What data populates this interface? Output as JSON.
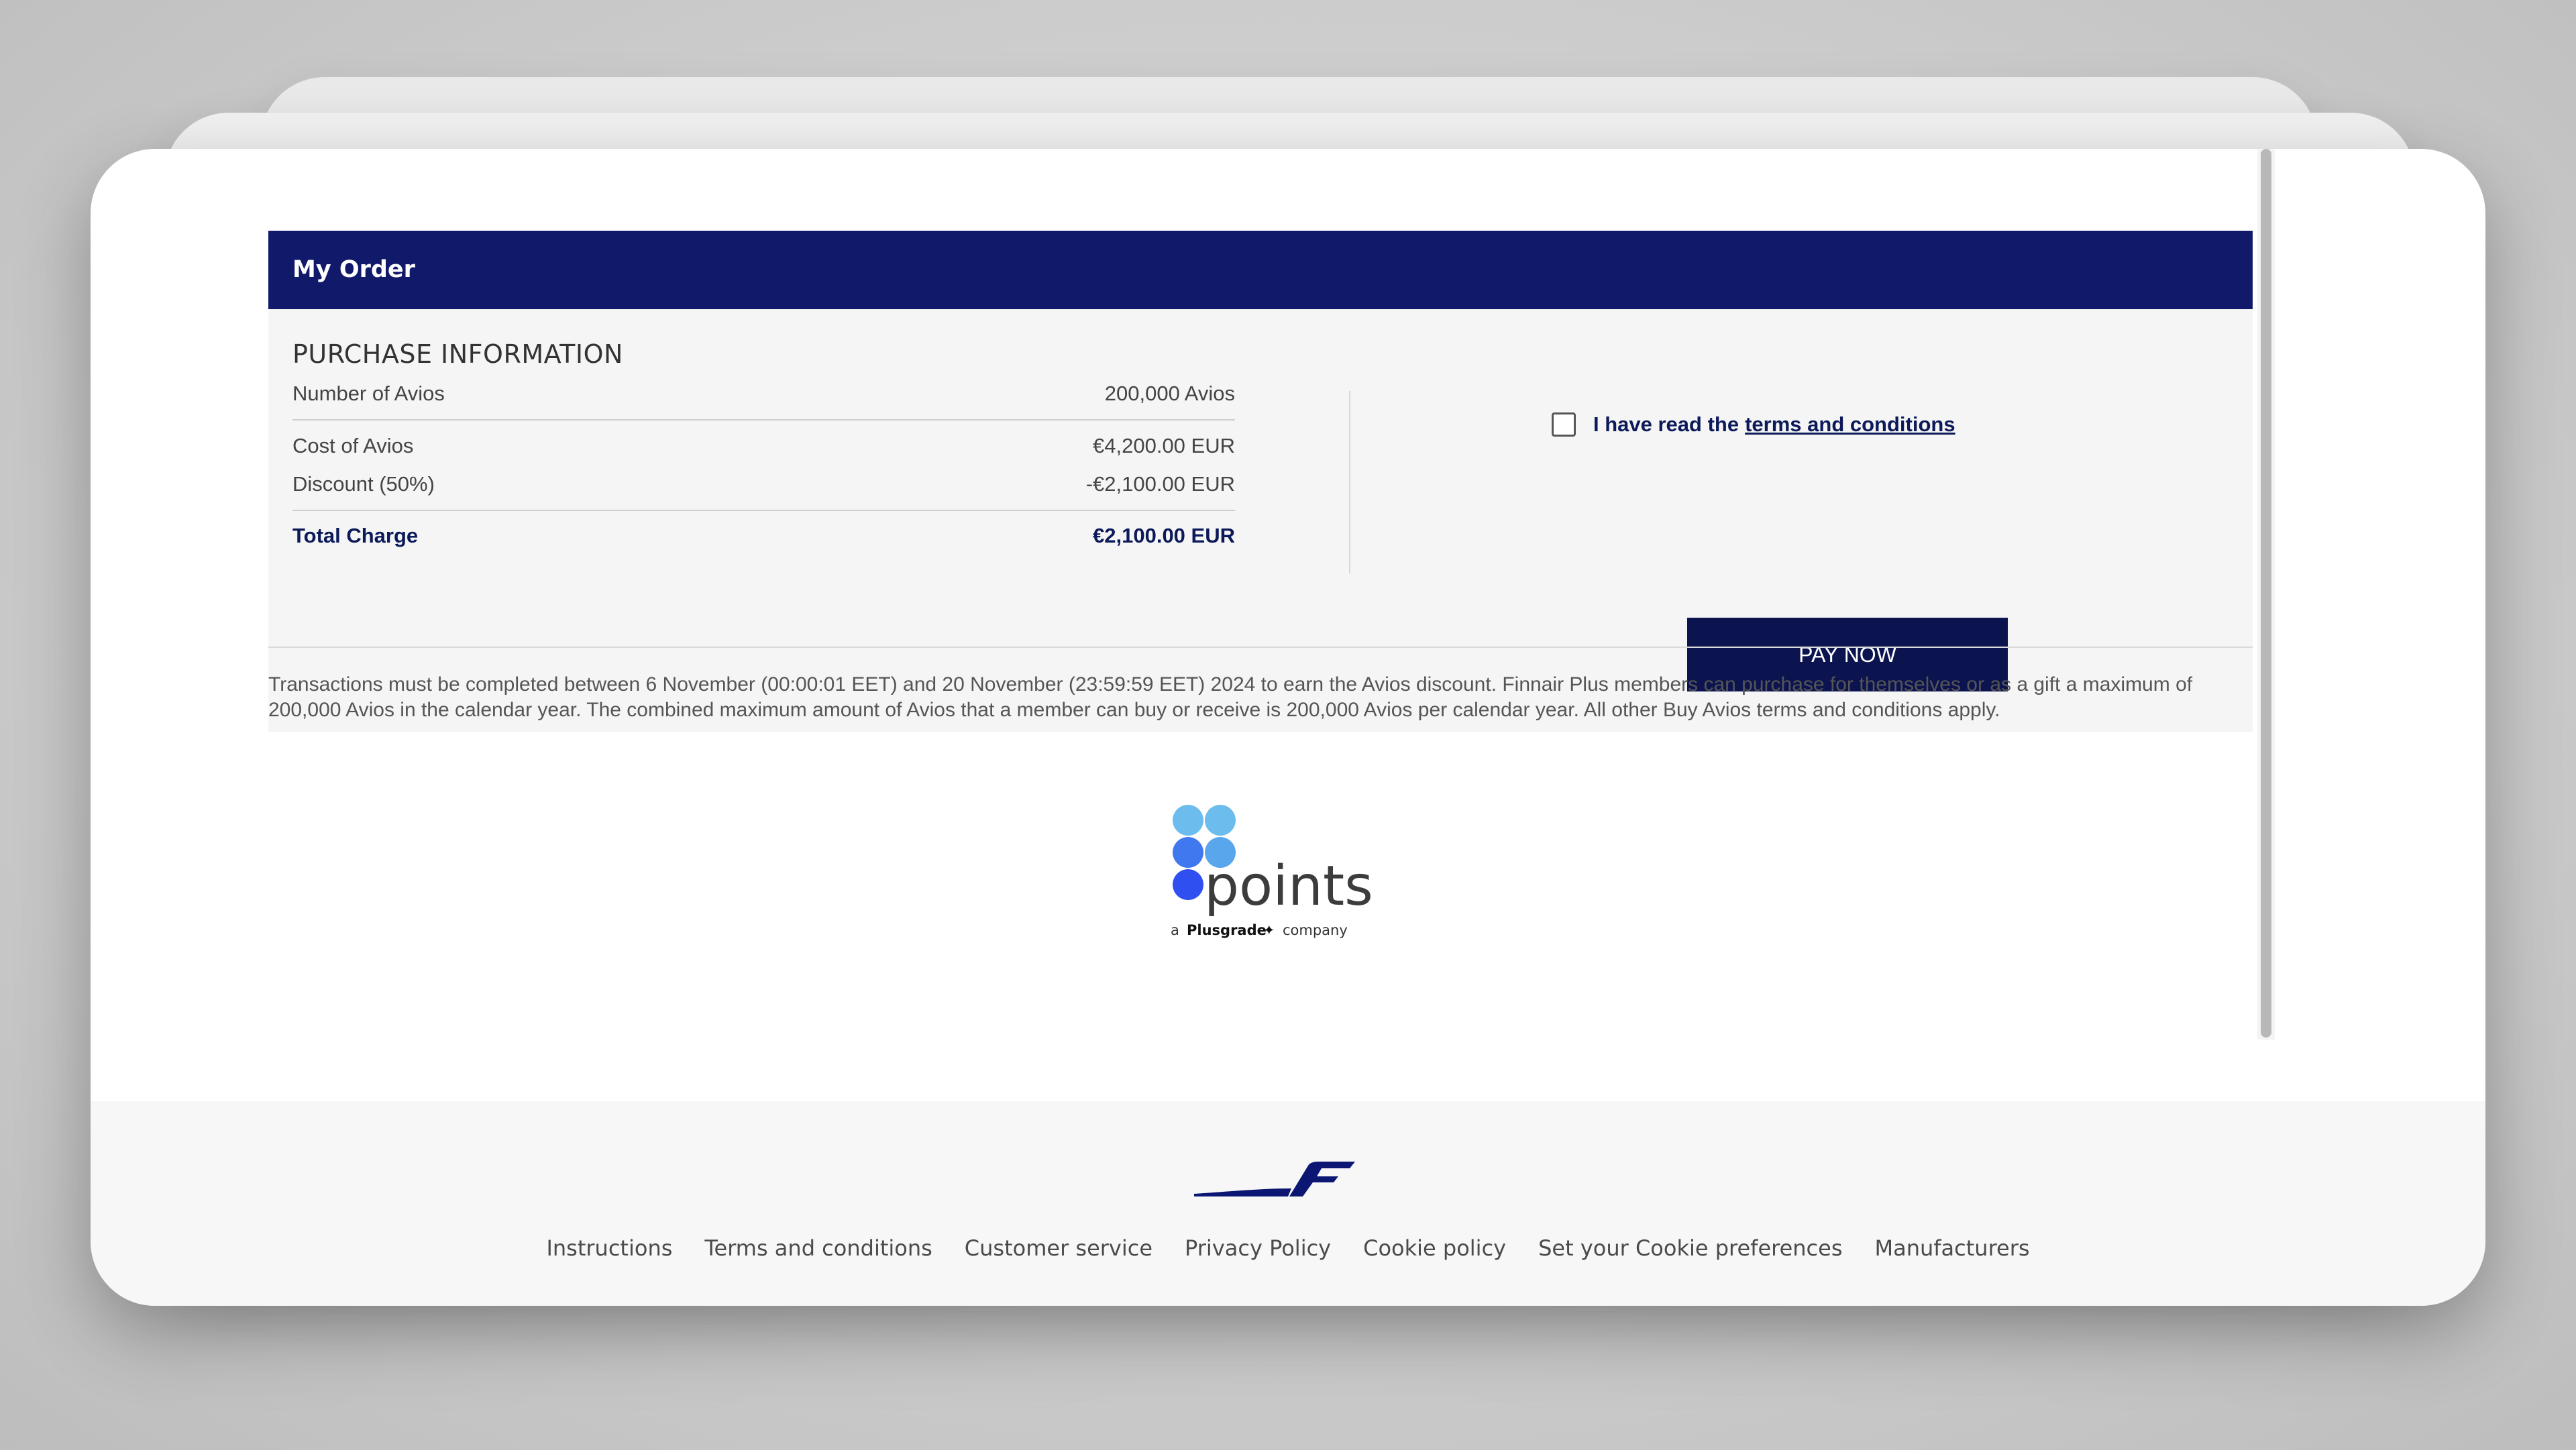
{
  "order": {
    "title": "My Order",
    "section_title": "PURCHASE INFORMATION",
    "rows": [
      {
        "label": "Number of Avios",
        "value": "200,000 Avios"
      },
      {
        "label": "Cost of Avios",
        "value": "€4,200.00 EUR"
      },
      {
        "label": "Discount (50%)",
        "value": "-€2,100.00 EUR"
      }
    ],
    "total": {
      "label": "Total Charge",
      "value": "€2,100.00 EUR"
    }
  },
  "terms": {
    "checked": false,
    "text": "I have read the",
    "link_text": "terms and conditions"
  },
  "pay_button": {
    "label": "PAY NOW"
  },
  "disclaimer": "Transactions must be completed between 6 November (00:00:01 EET) and 20 November (23:59:59 EET) 2024 to earn the Avios discount. Finnair Plus members can purchase for themselves or as a gift a maximum of 200,000 Avios in the calendar year. The combined maximum amount of Avios that a member can buy or receive is 200,000 Avios per calendar year. All other Buy Avios terms and conditions apply.",
  "points_logo": {
    "wordmark": "points",
    "tagline_prefix": "a",
    "tagline_brand": "Plusgrade",
    "tagline_suffix": "company"
  },
  "footer": {
    "links": [
      "Instructions",
      "Terms and conditions",
      "Customer service",
      "Privacy Policy",
      "Cookie policy",
      "Set your Cookie preferences",
      "Manufacturers"
    ]
  },
  "colors": {
    "header_navy": "#11196a",
    "button_navy": "#0c1450",
    "text_navy": "#0c1a5a",
    "points_light_blue": "#5db3ec",
    "points_blue": "#3b63f0"
  },
  "icons": [
    "checkbox-icon",
    "points-logo",
    "finnair-logo"
  ]
}
